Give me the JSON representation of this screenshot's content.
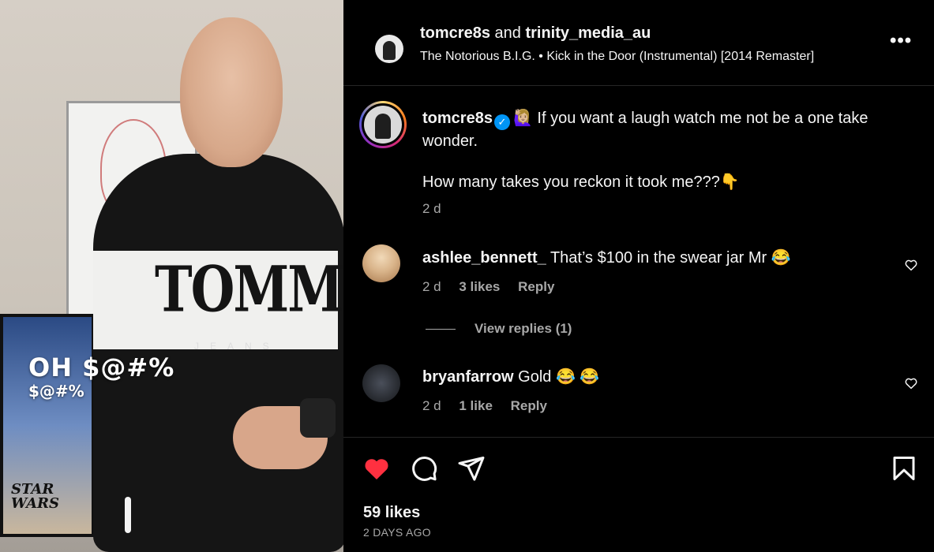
{
  "media": {
    "overlay_line1": "OH $@#%",
    "overlay_line2": "$@#%",
    "shirt_logo": "TOMMY",
    "shirt_sub": "JEANS",
    "poster_title": "STAR WARS"
  },
  "header": {
    "user1": "tomcre8s",
    "and_text": "and",
    "user2": "trinity_media_au",
    "audio": "The Notorious B.I.G. • Kick in the Door (Instrumental) [2014 Remaster]",
    "more_label": "•••"
  },
  "caption": {
    "user": "tomcre8s",
    "text_line1": "🙋🏼‍♀️ If you want a laugh watch me not be a one take wonder.",
    "text_line2": "How many takes you reckon it took me???👇",
    "time": "2 d"
  },
  "comments": [
    {
      "user": "ashlee_bennett_",
      "text": "That’s $100 in the swear jar Mr 😂",
      "time": "2 d",
      "likes": "3 likes",
      "reply": "Reply",
      "view_replies": "View replies (1)"
    },
    {
      "user": "bryanfarrow",
      "text": "Gold 😂 😂",
      "time": "2 d",
      "likes": "1 like",
      "reply": "Reply"
    }
  ],
  "footer": {
    "likes": "59 likes",
    "time": "2 DAYS AGO"
  },
  "icons": {
    "like": "heart-filled-icon",
    "comment": "comment-bubble-icon",
    "share": "paper-plane-icon",
    "save": "bookmark-icon",
    "verified": "verified-badge-icon",
    "comment_like": "heart-outline-icon"
  },
  "colors": {
    "like_red": "#ff3040",
    "verified_blue": "#0095f6",
    "muted_text": "#a8a8a8"
  }
}
